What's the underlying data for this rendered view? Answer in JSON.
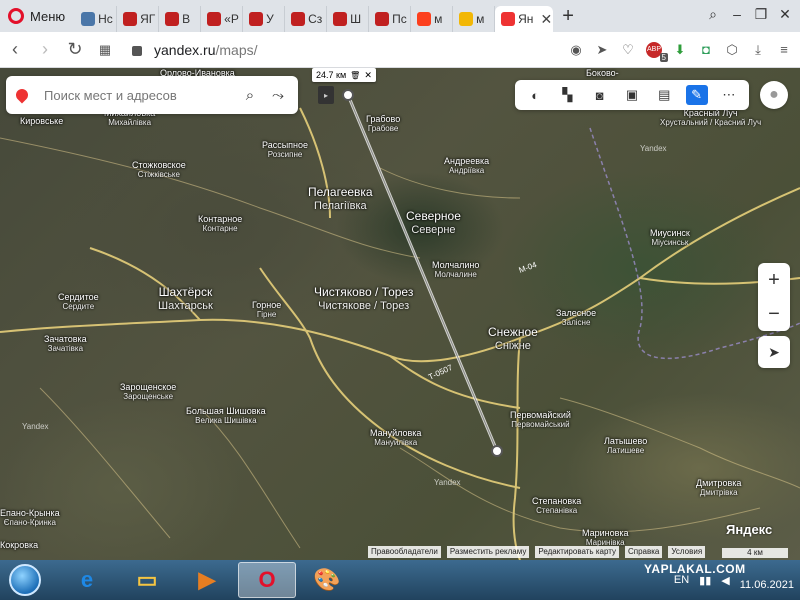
{
  "browser": {
    "menu_label": "Меню",
    "tabs": [
      {
        "label": "Нс",
        "icon": "vk-icon",
        "color": "#4a76a8"
      },
      {
        "label": "ЯГ",
        "icon": "yaplakal-icon",
        "color": "#c02020"
      },
      {
        "label": "В",
        "icon": "yaplakal-icon",
        "color": "#c02020"
      },
      {
        "label": "«Р",
        "icon": "yaplakal-icon",
        "color": "#c02020"
      },
      {
        "label": "У",
        "icon": "yaplakal-icon",
        "color": "#c02020"
      },
      {
        "label": "Сз",
        "icon": "yaplakal-icon",
        "color": "#c02020"
      },
      {
        "label": "Ш",
        "icon": "yaplakal-icon",
        "color": "#c02020"
      },
      {
        "label": "Пс",
        "icon": "yaplakal-icon",
        "color": "#c02020"
      },
      {
        "label": "м",
        "icon": "yandex-icon",
        "color": "#fc3f1d"
      },
      {
        "label": "м",
        "icon": "image-icon",
        "color": "#f2b705"
      },
      {
        "label": "Ян",
        "icon": "maps-pin-icon",
        "color": "#e33",
        "active": true
      }
    ],
    "url_host": "yandex.ru",
    "url_path": "/maps/",
    "adblock_count": "5"
  },
  "map": {
    "search_placeholder": "Поиск мест и адресов",
    "ruler_distance": "24.7 км",
    "zoom_in": "+",
    "zoom_out": "−",
    "logo": "Яндекс",
    "footer_links": [
      "Правообладатели",
      "Разместить рекламу",
      "Редактировать карту",
      "Справка",
      "Условия"
    ],
    "scale_label": "4 км",
    "road_labels": [
      "М-04",
      "Т-0507"
    ],
    "towns": [
      {
        "ru": "Кировське",
        "ua": ""
      },
      {
        "ru": "Михайловка",
        "ua": "Михайлівка"
      },
      {
        "ru": "Орлово-Ивановка",
        "ua": ""
      },
      {
        "ru": "Грабово",
        "ua": "Грабове"
      },
      {
        "ru": "Рассыпное",
        "ua": "Розсипне"
      },
      {
        "ru": "Стожковское",
        "ua": "Стіжківське"
      },
      {
        "ru": "Андреевка",
        "ua": "Андріївка"
      },
      {
        "ru": "Пелагеевка",
        "ua": "Пелагіївка"
      },
      {
        "ru": "Северное",
        "ua": "Северне"
      },
      {
        "ru": "Контарное",
        "ua": "Контарне"
      },
      {
        "ru": "Молчалино",
        "ua": "Молчалине"
      },
      {
        "ru": "Сердитое",
        "ua": "Сердите"
      },
      {
        "ru": "Шахтёрск",
        "ua": "Шахтарськ"
      },
      {
        "ru": "Горное",
        "ua": "Гірне"
      },
      {
        "ru": "Чистяково / Торез",
        "ua": "Чистякове / Торез"
      },
      {
        "ru": "Снежное",
        "ua": "Сніжне"
      },
      {
        "ru": "Залесное",
        "ua": "Залісне"
      },
      {
        "ru": "Зачатовка",
        "ua": "Зачатівка"
      },
      {
        "ru": "Зарощенское",
        "ua": "Зарощенське"
      },
      {
        "ru": "Большая Шишовка",
        "ua": "Велика Шишівка"
      },
      {
        "ru": "Мануйловка",
        "ua": "Мануйлівка"
      },
      {
        "ru": "Первомайский",
        "ua": "Первомайський"
      },
      {
        "ru": "Латышево",
        "ua": "Латишеве"
      },
      {
        "ru": "Степановка",
        "ua": "Степанівка"
      },
      {
        "ru": "Мариновка",
        "ua": "Маринівка"
      },
      {
        "ru": "Дмитровка",
        "ua": "Дмитрівка"
      },
      {
        "ru": "Миусинск",
        "ua": "Міусинськ"
      },
      {
        "ru": "Красный Луч",
        "ua": "Хрустальний / Красний Луч"
      },
      {
        "ru": "Боково-",
        "ua": ""
      },
      {
        "ru": "Епано-Крынка",
        "ua": "Єпано-Кринка"
      },
      {
        "ru": "Кокровка",
        "ua": ""
      }
    ],
    "watermarks": [
      "Yandex",
      "Yandex",
      "Yandex"
    ]
  },
  "taskbar": {
    "apps": [
      {
        "name": "internet-explorer-icon",
        "glyph": "e"
      },
      {
        "name": "file-explorer-icon",
        "glyph": "▭"
      },
      {
        "name": "media-player-icon",
        "glyph": "▶"
      },
      {
        "name": "opera-taskbar-icon",
        "glyph": "O"
      },
      {
        "name": "paint-icon",
        "glyph": "🎨"
      }
    ],
    "lang": "EN",
    "date": "11.06.2021",
    "watermark": "YAPLAKAL.COM"
  }
}
